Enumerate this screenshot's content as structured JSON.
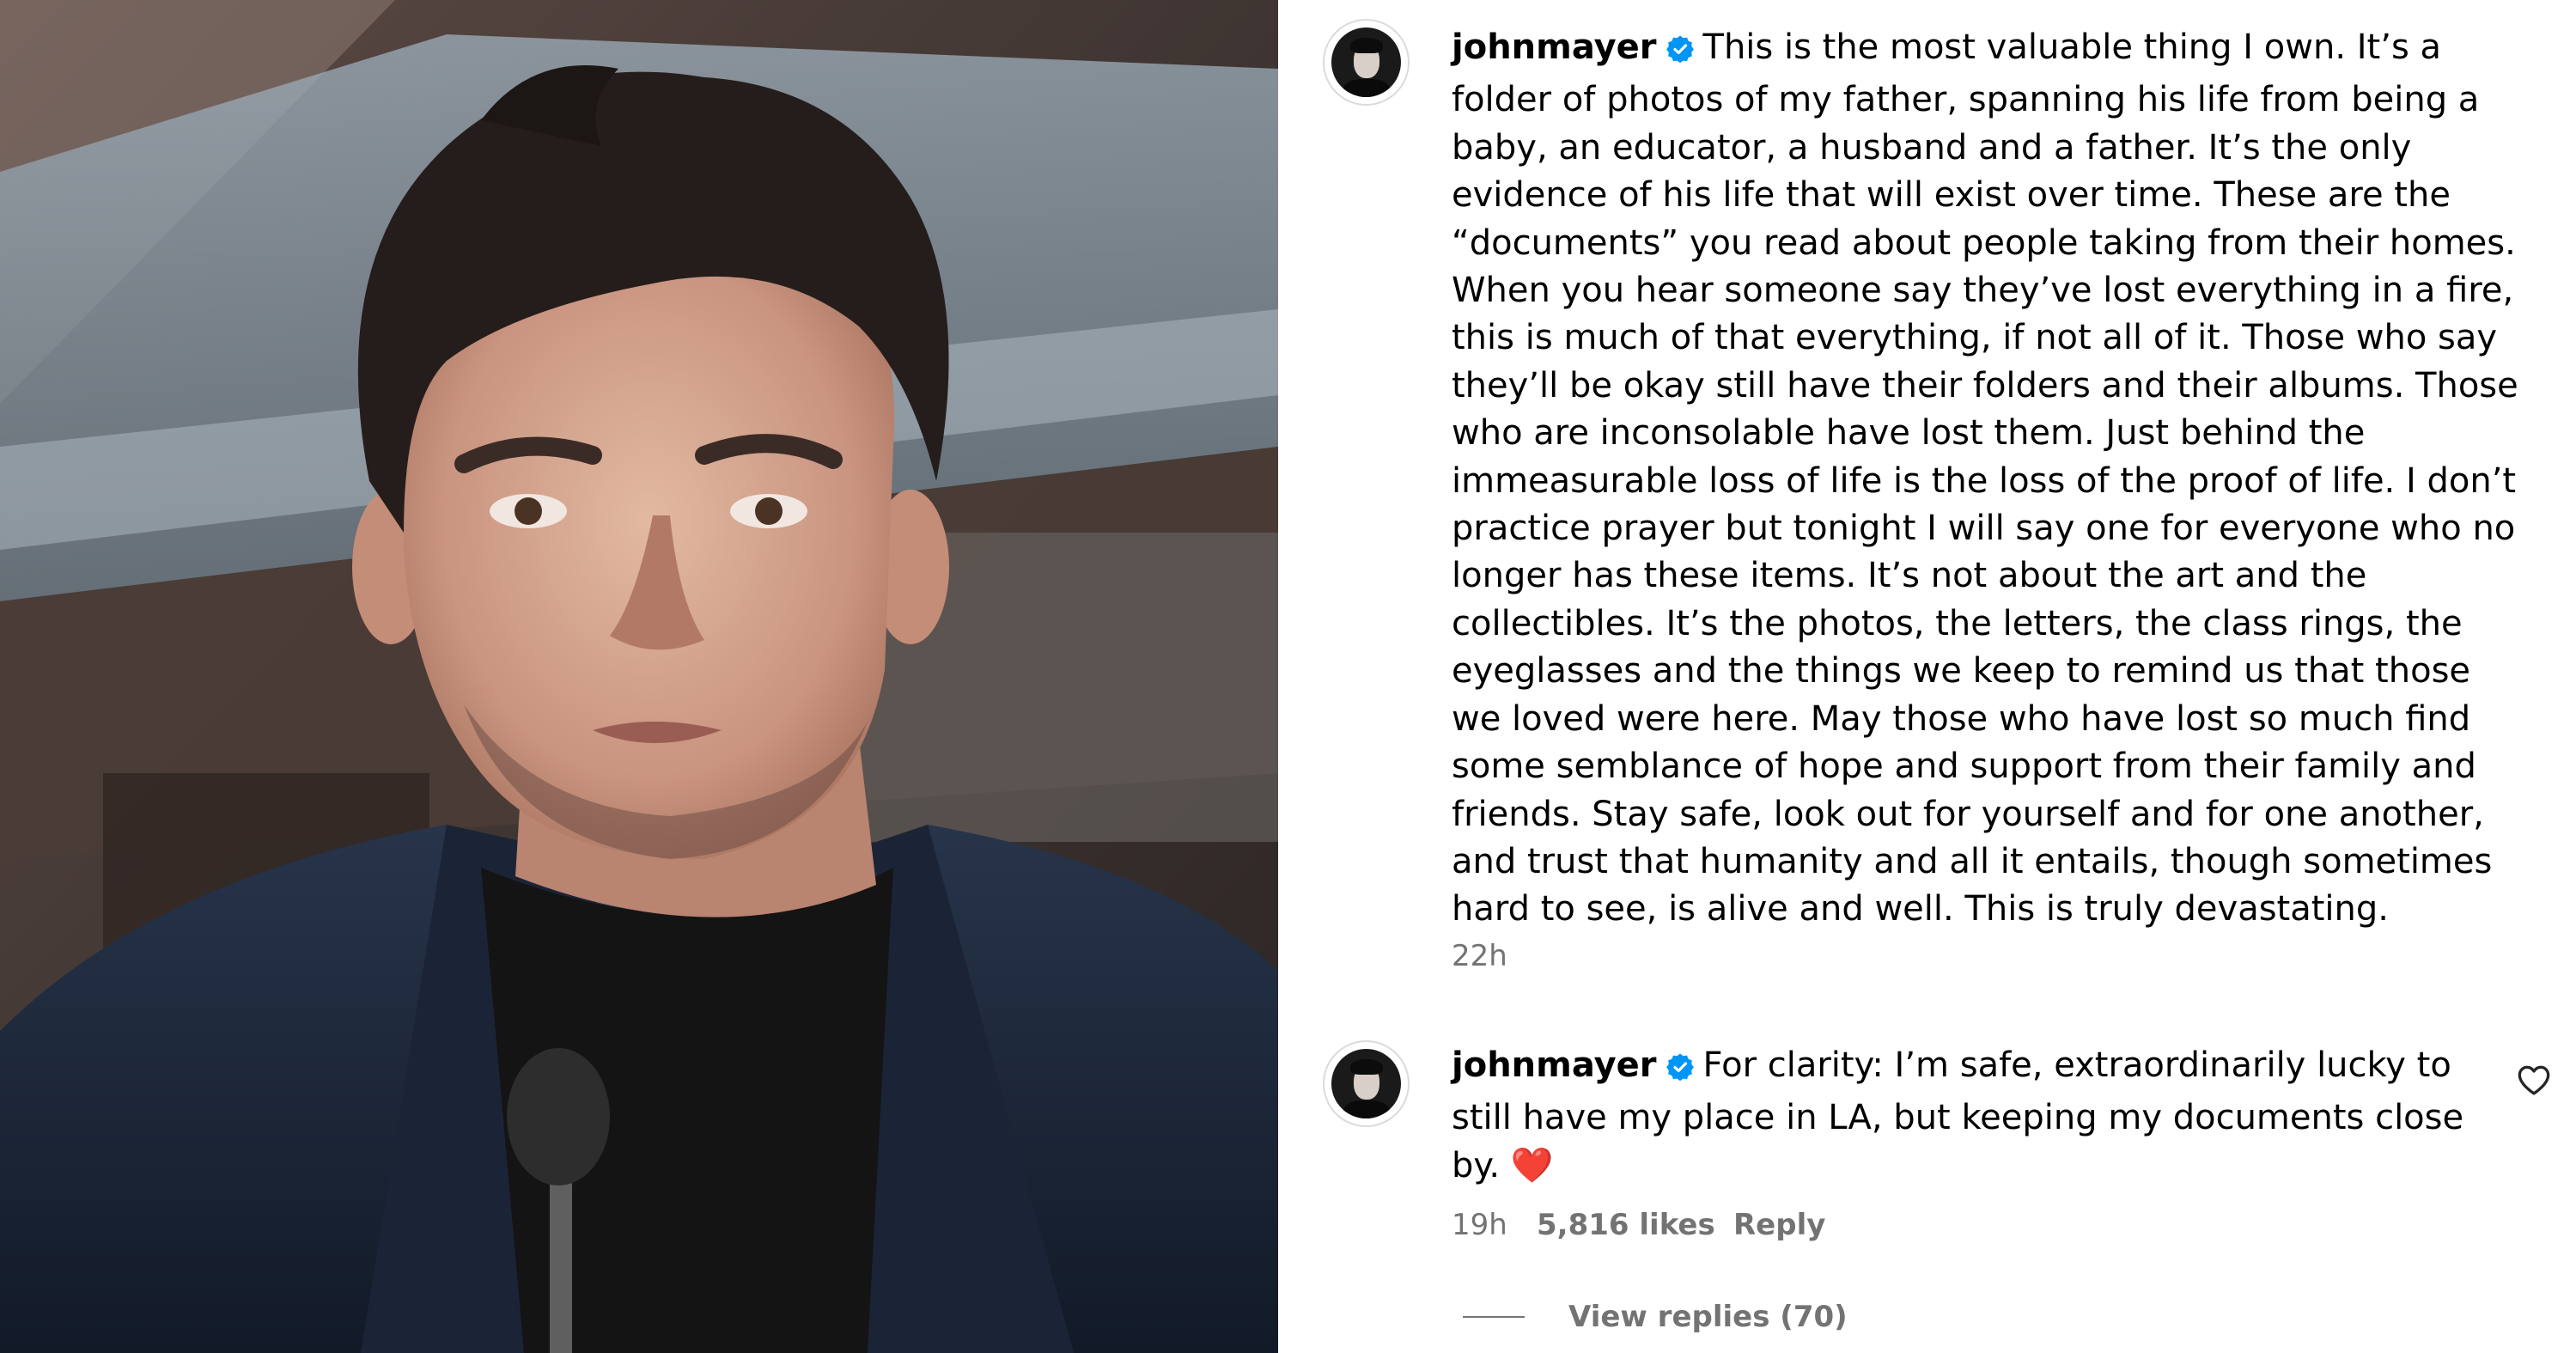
{
  "post": {
    "username": "johnmayer",
    "caption": "This is the most valuable thing I own. It’s a folder of photos of my father, spanning his life from being a baby, an educator, a husband and a father. It’s the only evidence of his life that will exist over time. These are the “documents” you read about people taking from their homes. When you hear someone say they’ve lost everything in a fire, this is much of that everything, if not all of it. Those who say they’ll be okay still have their folders and their albums. Those who are inconsolable have lost them. Just behind the immeasurable loss of life is the loss of the proof of life. I don’t practice prayer but tonight I will say one for everyone who no longer has these items. It’s not about the art and the collectibles. It’s the photos, the letters, the class rings, the eyeglasses and the things we keep to remind us that those we loved were here. May those who have lost so much find some semblance of hope and support from their family and friends. Stay safe, look out for yourself and for one another, and trust that humanity and all it entails, though sometimes hard to see, is alive and well. This is truly devastating.",
    "timestamp": "22h"
  },
  "comment": {
    "username": "johnmayer",
    "text": "For clarity: I’m safe, extraordinarily lucky to still have my place in LA, but keeping my documents close by. ❤️",
    "timestamp": "19h",
    "likes": "5,816 likes",
    "reply_label": "Reply",
    "view_replies": "View replies (70)"
  },
  "icons": {
    "verified": "verified-badge-icon",
    "like": "heart-outline-icon"
  },
  "colors": {
    "verified_blue": "#0095f6",
    "secondary_text": "#737373",
    "heart_red": "#e0245e"
  }
}
